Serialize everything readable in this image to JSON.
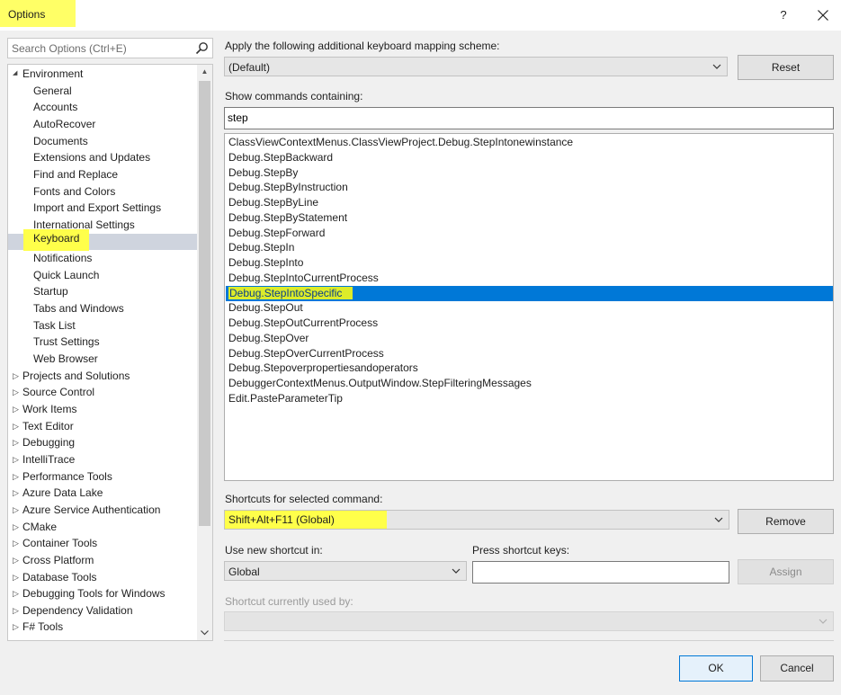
{
  "window": {
    "title": "Options",
    "help_label": "?",
    "close_icon": "close-icon"
  },
  "sidebar": {
    "search_placeholder": "Search Options (Ctrl+E)",
    "search_icon": "search-icon",
    "tree": [
      {
        "label": "Environment",
        "level": 0,
        "expanded": true
      },
      {
        "label": "General",
        "level": 1
      },
      {
        "label": "Accounts",
        "level": 1
      },
      {
        "label": "AutoRecover",
        "level": 1
      },
      {
        "label": "Documents",
        "level": 1
      },
      {
        "label": "Extensions and Updates",
        "level": 1
      },
      {
        "label": "Find and Replace",
        "level": 1
      },
      {
        "label": "Fonts and Colors",
        "level": 1
      },
      {
        "label": "Import and Export Settings",
        "level": 1
      },
      {
        "label": "International Settings",
        "level": 1
      },
      {
        "label": "Keyboard",
        "level": 1,
        "selected": true
      },
      {
        "label": "Notifications",
        "level": 1
      },
      {
        "label": "Quick Launch",
        "level": 1
      },
      {
        "label": "Startup",
        "level": 1
      },
      {
        "label": "Tabs and Windows",
        "level": 1
      },
      {
        "label": "Task List",
        "level": 1
      },
      {
        "label": "Trust Settings",
        "level": 1
      },
      {
        "label": "Web Browser",
        "level": 1
      },
      {
        "label": "Projects and Solutions",
        "level": 0,
        "expanded": false
      },
      {
        "label": "Source Control",
        "level": 0,
        "expanded": false
      },
      {
        "label": "Work Items",
        "level": 0,
        "expanded": false
      },
      {
        "label": "Text Editor",
        "level": 0,
        "expanded": false
      },
      {
        "label": "Debugging",
        "level": 0,
        "expanded": false
      },
      {
        "label": "IntelliTrace",
        "level": 0,
        "expanded": false
      },
      {
        "label": "Performance Tools",
        "level": 0,
        "expanded": false
      },
      {
        "label": "Azure Data Lake",
        "level": 0,
        "expanded": false
      },
      {
        "label": "Azure Service Authentication",
        "level": 0,
        "expanded": false
      },
      {
        "label": "CMake",
        "level": 0,
        "expanded": false
      },
      {
        "label": "Container Tools",
        "level": 0,
        "expanded": false
      },
      {
        "label": "Cross Platform",
        "level": 0,
        "expanded": false
      },
      {
        "label": "Database Tools",
        "level": 0,
        "expanded": false
      },
      {
        "label": "Debugging Tools for Windows",
        "level": 0,
        "expanded": false
      },
      {
        "label": "Dependency Validation",
        "level": 0,
        "expanded": false
      },
      {
        "label": "F# Tools",
        "level": 0,
        "expanded": false
      }
    ]
  },
  "main": {
    "mapping_scheme_label": "Apply the following additional keyboard mapping scheme:",
    "mapping_scheme_value": "(Default)",
    "reset_label": "Reset",
    "show_commands_label": "Show commands containing:",
    "show_commands_value": "step",
    "commands": [
      "ClassViewContextMenus.ClassViewProject.Debug.StepIntonewinstance",
      "Debug.StepBackward",
      "Debug.StepBy",
      "Debug.StepByInstruction",
      "Debug.StepByLine",
      "Debug.StepByStatement",
      "Debug.StepForward",
      "Debug.StepIn",
      "Debug.StepInto",
      "Debug.StepIntoCurrentProcess",
      "Debug.StepIntoSpecific",
      "Debug.StepOut",
      "Debug.StepOutCurrentProcess",
      "Debug.StepOver",
      "Debug.StepOverCurrentProcess",
      "Debug.Stepoverpropertiesandoperators",
      "DebuggerContextMenus.OutputWindow.StepFilteringMessages",
      "Edit.PasteParameterTip"
    ],
    "selected_command_index": 10,
    "shortcuts_label": "Shortcuts for selected command:",
    "shortcuts_value": "Shift+Alt+F11 (Global)",
    "remove_label": "Remove",
    "use_shortcut_in_label": "Use new shortcut in:",
    "use_shortcut_in_value": "Global",
    "press_keys_label": "Press shortcut keys:",
    "press_keys_value": "",
    "assign_label": "Assign",
    "used_by_label": "Shortcut currently used by:",
    "ok_label": "OK",
    "cancel_label": "Cancel"
  },
  "colors": {
    "highlight_yellow": "#ffff4a",
    "selection_blue": "#0078d7",
    "tree_selection": "#cfd4de"
  }
}
